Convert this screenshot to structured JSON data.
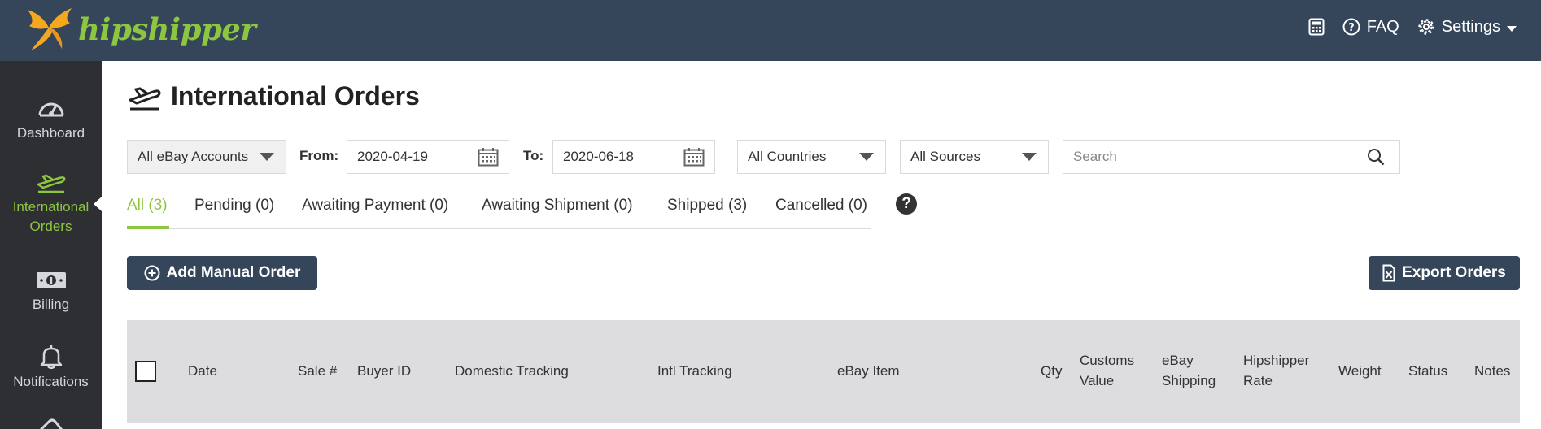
{
  "brand": {
    "name": "hipshipper",
    "accent": "#8dc63f",
    "nav_bg": "#35465b"
  },
  "topnav": {
    "calculator_icon": "calculator-icon",
    "faq_label": "FAQ",
    "settings_label": "Settings"
  },
  "sidebar": {
    "items": [
      {
        "label": "Dashboard",
        "icon": "gauge-icon"
      },
      {
        "label": "International",
        "label2": "Orders",
        "icon": "airplane-icon",
        "active": true
      },
      {
        "label": "Billing",
        "icon": "money-icon"
      },
      {
        "label": "Notifications",
        "icon": "bell-icon"
      }
    ]
  },
  "page": {
    "title": "International Orders"
  },
  "filters": {
    "account": "All eBay Accounts",
    "from_label": "From:",
    "from_value": "2020-04-19",
    "to_label": "To:",
    "to_value": "2020-06-18",
    "countries": "All Countries",
    "sources": "All Sources",
    "search_placeholder": "Search"
  },
  "tabs": [
    {
      "label": "All (3)",
      "active": true
    },
    {
      "label": "Pending (0)"
    },
    {
      "label": "Awaiting Payment (0)"
    },
    {
      "label": "Awaiting Shipment (0)"
    },
    {
      "label": "Shipped (3)"
    },
    {
      "label": "Cancelled (0)"
    }
  ],
  "help_symbol": "?",
  "buttons": {
    "add_manual": "Add Manual Order",
    "export": "Export Orders"
  },
  "table": {
    "columns": {
      "date": "Date",
      "sale": "Sale #",
      "buyer": "Buyer ID",
      "domestic": "Domestic Tracking",
      "intl": "Intl Tracking",
      "item": "eBay Item",
      "qty": "Qty",
      "customs_1": "Customs",
      "customs_2": "Value",
      "shipping_1": "eBay",
      "shipping_2": "Shipping",
      "rate_1": "Hipshipper",
      "rate_2": "Rate",
      "weight": "Weight",
      "status": "Status",
      "notes": "Notes"
    }
  }
}
